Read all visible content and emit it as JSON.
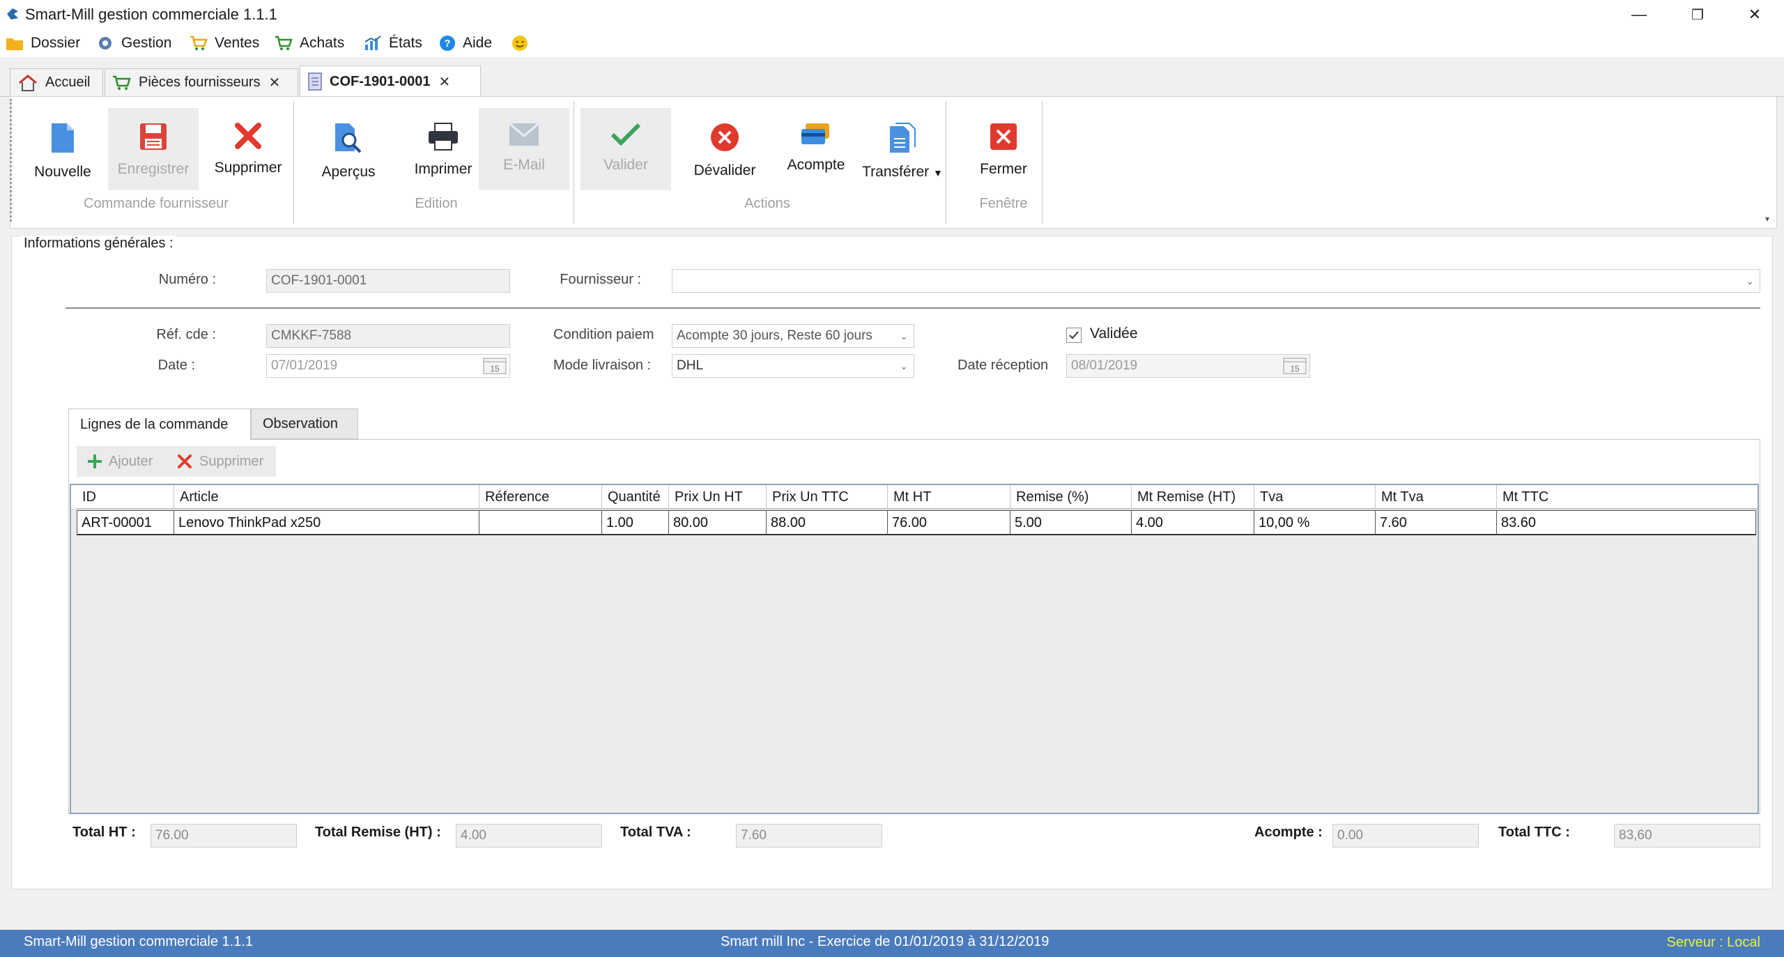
{
  "window": {
    "title": "Smart-Mill gestion commerciale 1.1.1",
    "minimize": "—",
    "restore": "❐",
    "close": "✕"
  },
  "menu": {
    "items": [
      {
        "label": "Dossier",
        "icon": "folder-icon"
      },
      {
        "label": "Gestion",
        "icon": "gear-icon"
      },
      {
        "label": "Ventes",
        "icon": "cart-icon"
      },
      {
        "label": "Achats",
        "icon": "cart-icon"
      },
      {
        "label": "États",
        "icon": "chart-icon"
      },
      {
        "label": "Aide",
        "icon": "help-icon"
      }
    ]
  },
  "doc_tabs": [
    {
      "label": "Accueil",
      "closable": false
    },
    {
      "label": "Pièces fournisseurs",
      "closable": true
    },
    {
      "label": "COF-1901-0001",
      "closable": true,
      "active": true
    }
  ],
  "ribbon": {
    "groups": [
      {
        "label": "Commande fournisseur"
      },
      {
        "label": "Edition"
      },
      {
        "label": "Actions"
      },
      {
        "label": "Fenêtre"
      }
    ],
    "buttons": {
      "nouvelle": "Nouvelle",
      "enregistrer": "Enregistrer",
      "supprimer": "Supprimer",
      "apercus": "Aperçus",
      "imprimer": "Imprimer",
      "email": "E-Mail",
      "valider": "Valider",
      "devalider": "Dévalider",
      "acompte": "Acompte",
      "transferer": "Transférer",
      "fermer": "Fermer"
    }
  },
  "form": {
    "section_title": "Informations générales :",
    "numero_label": "Numéro :",
    "numero_value": "COF-1901-0001",
    "fournisseur_label": "Fournisseur :",
    "fournisseur_value": "",
    "ref_label": "Réf. cde :",
    "ref_value": "CMKKF-7588",
    "date_label": "Date :",
    "date_value": "07/01/2019",
    "condition_label": "Condition paiem",
    "condition_value": "Acompte 30 jours, Reste 60 jours",
    "mode_label": "Mode livraison :",
    "mode_value": "DHL",
    "validee_label": "Validée",
    "validee_checked": true,
    "date_reception_label": "Date réception",
    "date_reception_value": "08/01/2019",
    "calendar_day": "15"
  },
  "inner_tabs": [
    {
      "label": "Lignes de la commande",
      "active": true
    },
    {
      "label": "Observation",
      "active": false
    }
  ],
  "lines_toolbar": {
    "add": "Ajouter",
    "delete": "Supprimer"
  },
  "grid": {
    "columns": [
      "ID",
      "Article",
      "Réference",
      "Quantité",
      "Prix Un HT",
      "Prix Un TTC",
      "Mt HT",
      "Remise (%)",
      "Mt Remise (HT)",
      "Tva",
      "Mt Tva",
      "Mt TTC"
    ],
    "rows": [
      [
        "ART-00001",
        "Lenovo ThinkPad x250",
        "",
        "1.00",
        "80.00",
        "88.00",
        "76.00",
        "5.00",
        "4.00",
        "10,00 %",
        "7.60",
        "83.60"
      ]
    ]
  },
  "totals": {
    "ht_label": "Total HT :",
    "ht_value": "76.00",
    "remise_label": "Total Remise (HT) :",
    "remise_value": "4.00",
    "tva_label": "Total TVA :",
    "tva_value": "7.60",
    "acompte_label": "Acompte :",
    "acompte_value": "0.00",
    "ttc_label": "Total TTC :",
    "ttc_value": "83,60"
  },
  "status": {
    "left": "Smart-Mill gestion commerciale 1.1.1",
    "center": "Smart mill Inc - Exercice de 01/01/2019 à 31/12/2019",
    "right": "Serveur : Local"
  },
  "colors": {
    "statusbar": "#4a7bbd",
    "server_text": "#e6f53a",
    "delete_red": "#e03a2f",
    "accent_blue": "#3b8de0"
  }
}
